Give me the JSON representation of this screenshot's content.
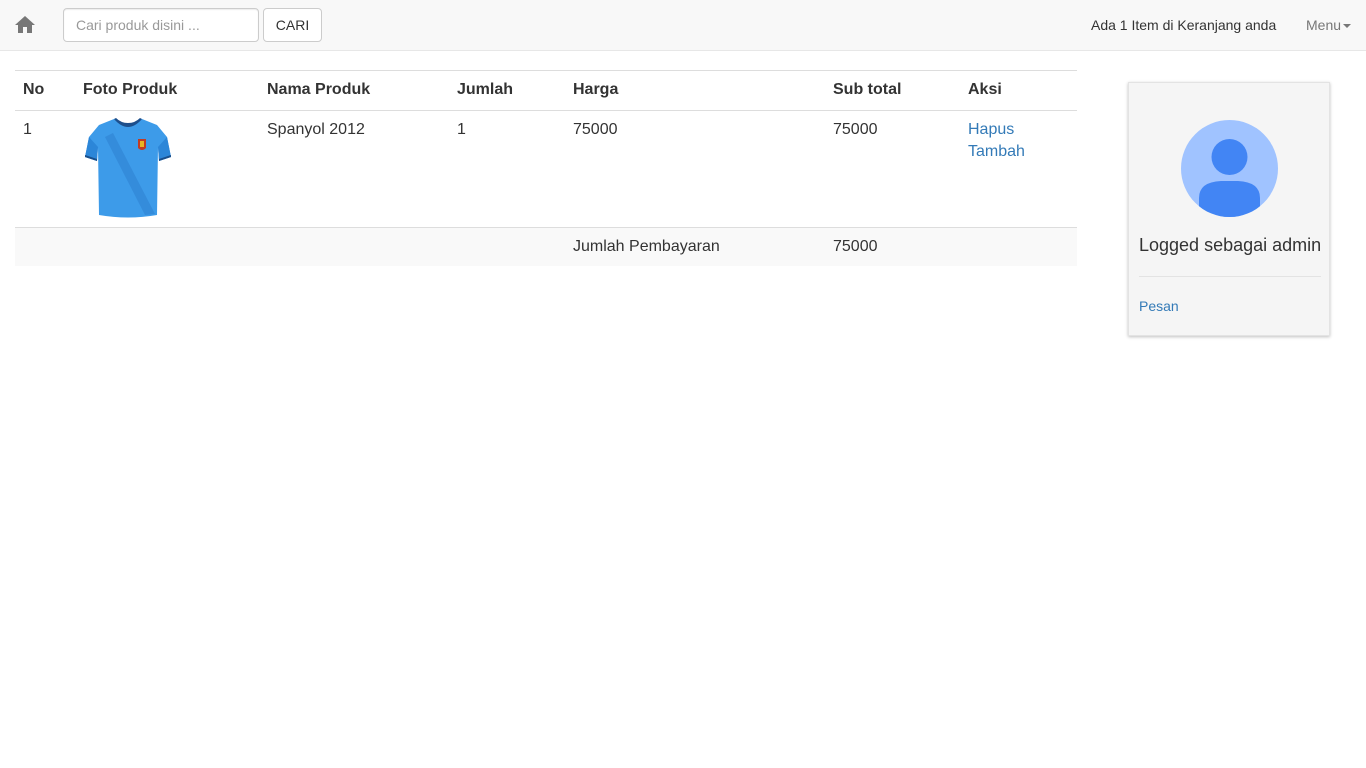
{
  "navbar": {
    "home_icon": "home-icon",
    "search": {
      "placeholder": "Cari produk disini ...",
      "value": ""
    },
    "search_button": "CARI",
    "cart_info": "Ada 1 Item di Keranjang anda",
    "menu_label": "Menu",
    "menu_icon": "caret-down-icon"
  },
  "cart": {
    "headers": {
      "no": "No",
      "foto": "Foto Produk",
      "nama": "Nama Produk",
      "jumlah": "Jumlah",
      "harga": "Harga",
      "subtotal": "Sub total",
      "aksi": "Aksi"
    },
    "rows": [
      {
        "no": "1",
        "foto": "jersey-shirt-image",
        "nama": "Spanyol 2012",
        "jumlah": "1",
        "harga": "75000",
        "subtotal": "75000",
        "aksi_hapus": "Hapus",
        "aksi_tambah": "Tambah"
      }
    ],
    "footer": {
      "label": "Jumlah Pembayaran",
      "total": "75000"
    }
  },
  "user_panel": {
    "avatar_icon": "user-avatar-icon",
    "logged_text": "Logged sebagai admin",
    "link": "Pesan"
  },
  "colors": {
    "navbar_bg": "#f8f8f8",
    "link": "#337ab7",
    "avatar_bg": "#a0c3ff",
    "avatar_fg": "#4285f4",
    "shirt": "#3d9be9"
  }
}
